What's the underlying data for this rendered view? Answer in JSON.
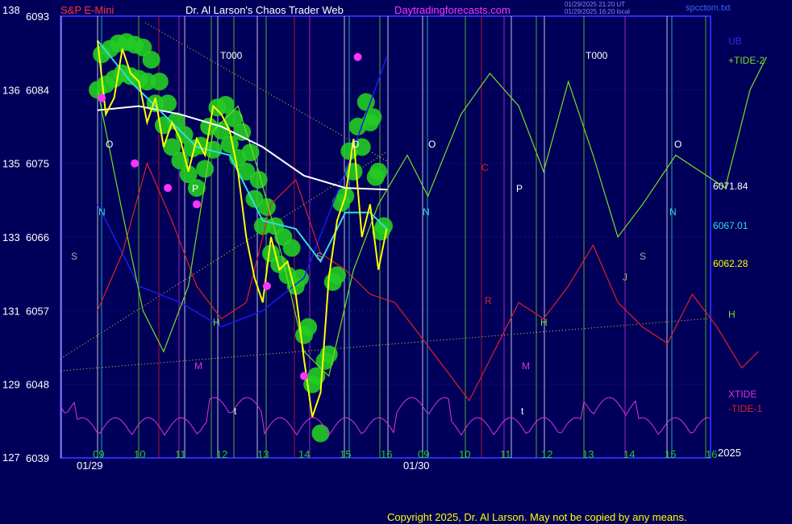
{
  "header": {
    "symbol_number": "138",
    "symbol": "S&P E-Mini",
    "title": "Dr. Al Larson's Chaos Trader Web",
    "site": "Daytradingforecasts.com",
    "stamp_line1": "01/29/2025 21:20 UT",
    "stamp_line2": "01/29/2025 16:20 local",
    "filename": "spcctom.txt"
  },
  "colors": {
    "background": "#00005a",
    "plot_border": "#2a2aff",
    "price": "#ffff00",
    "ma_white": "#ffffff",
    "ma_cyan": "#33dddd",
    "bubbles": "#22cc22",
    "tide2": "#77dd22",
    "tide1": "#dd2222",
    "xtide": "#dd33dd",
    "ub": "#1a1aee"
  },
  "chart_data": {
    "type": "line",
    "y_axis_price": {
      "range": [
        6039,
        6093
      ],
      "ticks": [
        6039,
        6048,
        6057,
        6066,
        6075,
        6084,
        6093
      ]
    },
    "y_axis_tide": {
      "range": [
        127,
        138
      ],
      "ticks": [
        127,
        129,
        131,
        133,
        135,
        136,
        138
      ]
    },
    "x_tick_labels": [
      "09",
      "10",
      "11",
      "12",
      "13",
      "14",
      "15",
      "16",
      "09",
      "10",
      "11",
      "12",
      "13",
      "14",
      "15",
      "16"
    ],
    "date_labels": [
      "01/29",
      "01/30"
    ],
    "year_label": "2025",
    "right_labels": [
      {
        "text": "UB",
        "color": "#2a2aff"
      },
      {
        "text": "+TIDE-2",
        "color": "#77dd22"
      },
      {
        "text": "6071.84",
        "color": "#ffffff"
      },
      {
        "text": "6067.01",
        "color": "#33dddd"
      },
      {
        "text": "6062.28",
        "color": "#ffff00"
      },
      {
        "text": "H",
        "color": "#77dd22"
      },
      {
        "text": "XTIDE",
        "color": "#dd33dd"
      },
      {
        "text": "-TIDE-1",
        "color": "#dd2222"
      }
    ],
    "annotations": [
      "T000",
      "T000",
      "O",
      "O",
      "O",
      "O",
      "N",
      "N",
      "N",
      "S",
      "S",
      "S",
      "P",
      "P",
      "C",
      "R",
      "H",
      "H",
      "M",
      "M",
      "J",
      "t",
      "t"
    ],
    "price_series": {
      "name": "S&P E-Mini",
      "hour": [
        9.0,
        9.2,
        9.4,
        9.6,
        9.8,
        10.0,
        10.2,
        10.4,
        10.6,
        10.8,
        11.0,
        11.2,
        11.4,
        11.6,
        11.8,
        12.0,
        12.2,
        12.4,
        12.6,
        12.8,
        13.0,
        13.2,
        13.4,
        13.6,
        13.8,
        14.0,
        14.2,
        14.4,
        14.6,
        14.8,
        15.0,
        15.2,
        15.4,
        15.6,
        15.8,
        16.0
      ],
      "value": [
        6090,
        6081,
        6083,
        6089,
        6086,
        6085,
        6080,
        6083,
        6077,
        6080,
        6078,
        6074,
        6078,
        6076,
        6082,
        6081,
        6079,
        6074,
        6066,
        6061,
        6058,
        6066,
        6062,
        6063,
        6059,
        6051,
        6044,
        6047,
        6061,
        6068,
        6071,
        6078,
        6066,
        6070,
        6062,
        6067
      ]
    },
    "ma_white": {
      "name": "6071.84",
      "hour": [
        9.0,
        10.0,
        11.0,
        12.0,
        13.0,
        14.0,
        15.0,
        16.0
      ],
      "value": [
        6081.5,
        6082.0,
        6081.0,
        6079.5,
        6077.0,
        6073.5,
        6072.0,
        6071.8
      ]
    },
    "ma_cyan": {
      "name": "6067.01",
      "hour": [
        9.0,
        9.8,
        10.6,
        11.4,
        12.2,
        13.0,
        13.8,
        14.4,
        15.0,
        15.6,
        16.0
      ],
      "value": [
        6090,
        6085,
        6081,
        6077,
        6076,
        6068,
        6067,
        6063,
        6069,
        6069,
        6067
      ]
    },
    "tide2": {
      "name": "+TIDE-2",
      "hour": [
        9.0,
        9.6,
        10.1,
        10.6,
        11.2,
        11.8,
        12.4,
        12.9,
        13.5,
        14.0,
        14.6,
        15.2,
        15.8,
        16.5,
        17.0,
        17.8,
        18.5,
        19.2,
        19.8,
        20.4,
        21.0,
        21.6,
        22.2,
        23.0,
        23.6,
        24.2,
        24.8,
        25.2
      ],
      "value": [
        6084,
        6069,
        6057,
        6052,
        6060,
        6079,
        6082,
        6074,
        6063,
        6052,
        6049,
        6062,
        6070,
        6076,
        6071,
        6081,
        6086,
        6082,
        6074,
        6085,
        6076,
        6066,
        6070,
        6076,
        6074,
        6072,
        6084,
        6088
      ]
    },
    "tide1": {
      "name": "-TIDE-1",
      "hour": [
        9.0,
        9.6,
        10.2,
        10.8,
        11.4,
        12.0,
        12.6,
        13.2,
        13.8,
        14.4,
        15.0,
        15.6,
        16.2,
        16.8,
        17.4,
        18.0,
        18.6,
        19.2,
        19.8,
        20.4,
        21.0,
        21.6,
        22.2,
        22.8,
        23.4,
        24.0,
        24.6,
        25.0
      ],
      "value": [
        6057,
        6064,
        6075,
        6068,
        6060,
        6056,
        6058,
        6070,
        6073,
        6064,
        6062,
        6059,
        6058,
        6054,
        6050,
        6046,
        6052,
        6058,
        6056,
        6060,
        6065,
        6058,
        6055,
        6053,
        6059,
        6055,
        6050,
        6052
      ]
    },
    "ub": {
      "name": "UB",
      "hour": [
        9.0,
        10.0,
        11.0,
        12.0,
        13.0,
        14.0,
        15.0,
        16.0
      ],
      "value": [
        6070,
        6060,
        6058,
        6055,
        6057,
        6061,
        6074,
        6088
      ]
    },
    "bubbles": {
      "hour": [
        9.0,
        9.6,
        10.2,
        10.8,
        11.4,
        12.0,
        12.6,
        13.2,
        13.8,
        14.4,
        15.0,
        15.6,
        16.0
      ],
      "value": [
        6086,
        6088,
        6087,
        6079,
        6074,
        6081,
        6076,
        6066,
        6062,
        6044,
        6073,
        6082,
        6062
      ]
    },
    "markers": {
      "hour": [
        9.1,
        9.9,
        10.7,
        11.4,
        13.1,
        14.0,
        15.3
      ],
      "value": [
        6083,
        6075,
        6072,
        6070,
        6060,
        6049,
        6088
      ]
    }
  }
}
